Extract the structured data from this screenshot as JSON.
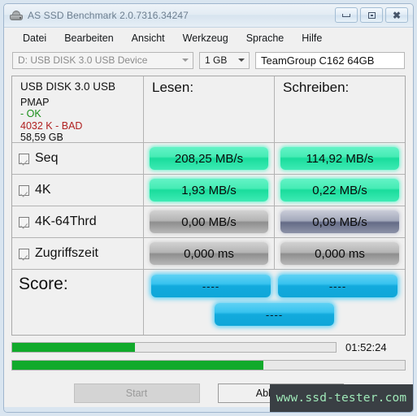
{
  "window": {
    "title": "AS SSD Benchmark 2.0.7316.34247",
    "icon": "hard-drive-icon",
    "controls": {
      "minimize": "minimize-icon",
      "restore": "restore-icon",
      "close": "close-icon"
    }
  },
  "menu": {
    "items": [
      "Datei",
      "Bearbeiten",
      "Ansicht",
      "Werkzeug",
      "Sprache",
      "Hilfe"
    ]
  },
  "toolbar": {
    "drive_select": "D: USB DISK 3.0 USB Device",
    "size_select": "1 GB",
    "name_field": "TeamGroup C162 64GB"
  },
  "drive_info": {
    "model": "USB DISK 3.0 USB",
    "firmware": "PMAP",
    "status_ok": "- OK",
    "status_bad": "4032 K - BAD",
    "capacity": "58,59 GB",
    "ok_color": "#1a8f1a",
    "bad_color": "#b02020"
  },
  "columns": {
    "read": "Lesen:",
    "write": "Schreiben:"
  },
  "tests": [
    {
      "label": "Seq",
      "checked": true,
      "read": "208,25 MB/s",
      "write": "114,92 MB/s",
      "read_state": "done",
      "write_state": "done"
    },
    {
      "label": "4K",
      "checked": true,
      "read": "1,93 MB/s",
      "write": "0,22 MB/s",
      "read_state": "done",
      "write_state": "done"
    },
    {
      "label": "4K-64Thrd",
      "checked": true,
      "read": "0,00 MB/s",
      "write": "0,09 MB/s",
      "read_state": "pending",
      "write_state": "running"
    },
    {
      "label": "Zugriffszeit",
      "checked": true,
      "read": "0,000 ms",
      "write": "0,000 ms",
      "read_state": "pending",
      "write_state": "pending"
    }
  ],
  "score": {
    "label": "Score:",
    "read": "----",
    "write": "----",
    "total": "----"
  },
  "progress": {
    "current_percent": 38,
    "total_percent": 64,
    "elapsed": "01:52:24",
    "fill_color": "#11aa2b"
  },
  "buttons": {
    "start": "Start",
    "start_enabled": false,
    "cancel": "Abbrechen",
    "cancel_enabled": true
  },
  "watermark": {
    "text": "www.ssd-tester.com"
  }
}
